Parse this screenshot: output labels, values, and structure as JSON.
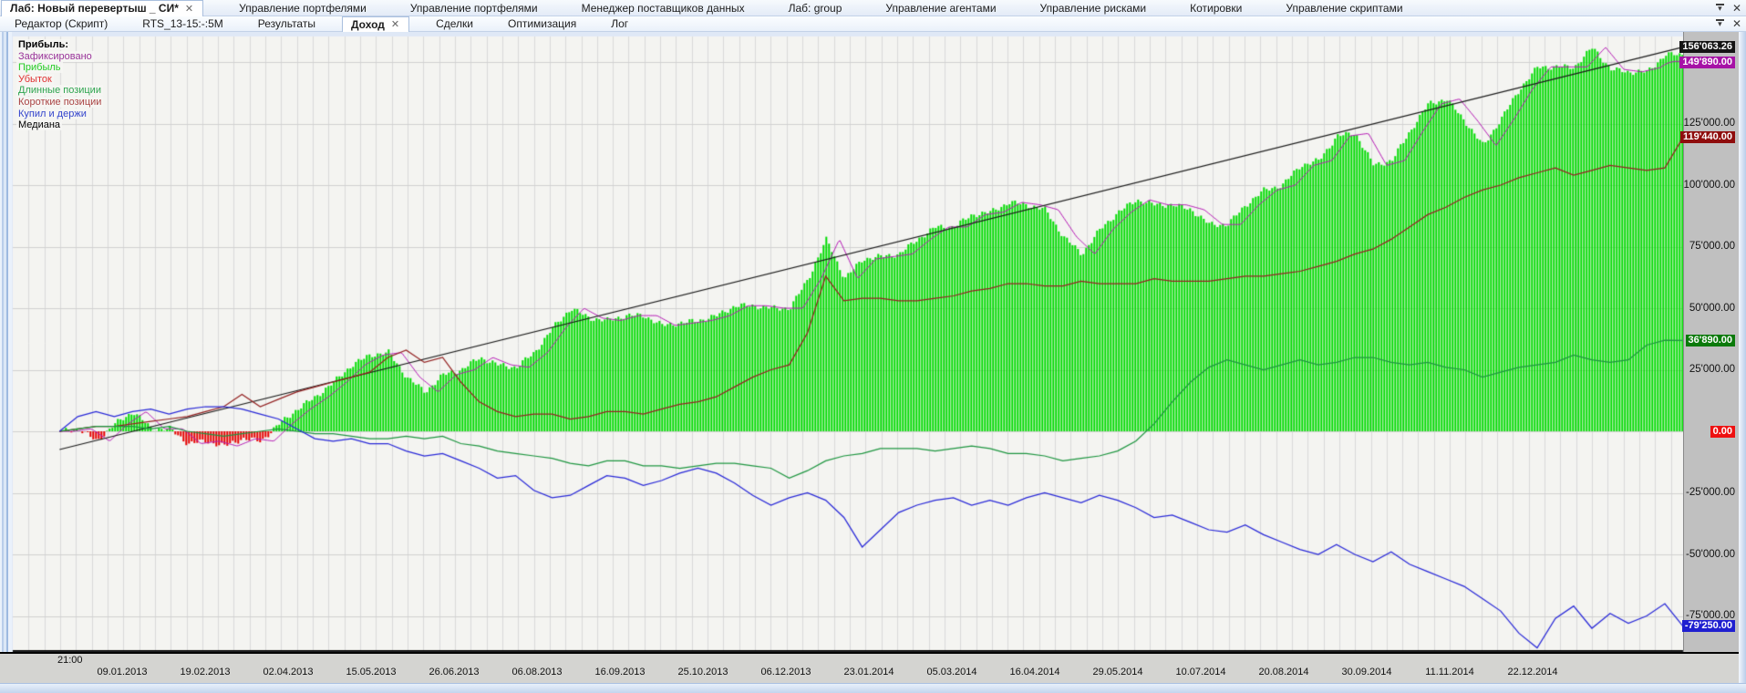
{
  "window": {
    "doc_tabs": [
      {
        "label": "Лаб: Новый перевертыш _ СИ*",
        "active": true,
        "closable": true
      },
      {
        "label": "Управление портфелями",
        "active": false,
        "closable": false
      },
      {
        "label": "Управление портфелями",
        "active": false,
        "closable": false
      },
      {
        "label": "Менеджер поставщиков данных",
        "active": false,
        "closable": false
      },
      {
        "label": "Лаб: group",
        "active": false,
        "closable": false
      },
      {
        "label": "Управление агентами",
        "active": false,
        "closable": false
      },
      {
        "label": "Управление рисками",
        "active": false,
        "closable": false
      },
      {
        "label": "Котировки",
        "active": false,
        "closable": false
      },
      {
        "label": "Управление скриптами",
        "active": false,
        "closable": false
      }
    ],
    "view_tabs": [
      {
        "label": "Редактор (Скрипт)",
        "active": false,
        "closable": false
      },
      {
        "label": "RTS_13-15:-:5M",
        "active": false,
        "closable": false
      },
      {
        "label": "Результаты",
        "active": false,
        "closable": false
      },
      {
        "label": "Доход",
        "active": true,
        "closable": true
      },
      {
        "label": "Сделки",
        "active": false,
        "closable": false
      },
      {
        "label": "Оптимизация",
        "active": false,
        "closable": false
      },
      {
        "label": "Лог",
        "active": false,
        "closable": false
      }
    ],
    "controls": {
      "menu_glyph": "▾",
      "close_glyph": "✕"
    }
  },
  "legend": {
    "title": "Прибыль:",
    "items": [
      {
        "label": "Зафиксировано",
        "color": "#993399"
      },
      {
        "label": "Прибыль",
        "color": "#22cc22"
      },
      {
        "label": "Убыток",
        "color": "#e03333"
      },
      {
        "label": "Длинные позиции",
        "color": "#2da44e"
      },
      {
        "label": "Короткие позиции",
        "color": "#aa4444"
      },
      {
        "label": "Купил и держи",
        "color": "#3344cc"
      },
      {
        "label": "Медиана",
        "color": "#000000"
      }
    ]
  },
  "chart_data": {
    "type": "area",
    "title": "Доход (equity and benchmark curves)",
    "values_scale": 1000,
    "x_start_frac": 0.028,
    "x_axis": {
      "time_label": "21:00",
      "labels": [
        "09.01.2013",
        "19.02.2013",
        "02.04.2013",
        "15.05.2013",
        "26.06.2013",
        "06.08.2013",
        "16.09.2013",
        "25.10.2013",
        "06.12.2013",
        "23.01.2014",
        "05.03.2014",
        "16.04.2014",
        "29.05.2014",
        "10.07.2014",
        "20.08.2014",
        "30.09.2014",
        "11.11.2014",
        "22.12.2014"
      ]
    },
    "y_axis": {
      "range": [
        -88500,
        163000
      ],
      "grid_step": 25000,
      "labels": [
        {
          "value": 156063.26,
          "text": "156'063.26",
          "style": "median"
        },
        {
          "value": 149890.0,
          "text": "149'890.00",
          "style": "fixed"
        },
        {
          "value": 125000.0,
          "text": "125'000.00",
          "style": "tick"
        },
        {
          "value": 119440.0,
          "text": "119'440.00",
          "style": "short"
        },
        {
          "value": 100000.0,
          "text": "100'000.00",
          "style": "tick"
        },
        {
          "value": 75000.0,
          "text": "75'000.00",
          "style": "tick"
        },
        {
          "value": 50000.0,
          "text": "50'000.00",
          "style": "tick"
        },
        {
          "value": 36890.0,
          "text": "36'890.00",
          "style": "long"
        },
        {
          "value": 25000.0,
          "text": "25'000.00",
          "style": "tick"
        },
        {
          "value": 0.0,
          "text": "0.00",
          "style": "zero"
        },
        {
          "value": -25000.0,
          "text": "-25'000.00",
          "style": "tick"
        },
        {
          "value": -50000.0,
          "text": "-50'000.00",
          "style": "tick"
        },
        {
          "value": -75000.0,
          "text": "-75'000.00",
          "style": "tick"
        },
        {
          "value": -79250.0,
          "text": "-79'250.00",
          "style": "buyhold"
        }
      ]
    },
    "colors": {
      "plot_bg": "#f4f4f1",
      "grid": "#dadada",
      "bar_profit": "#00dc00",
      "bar_loss": "#e60000",
      "fixed": "#b517b5",
      "short": "#942222",
      "long": "#1e9640",
      "buyhold": "#2828d8",
      "median": "#1a1a1a"
    },
    "equity_bars": {
      "name": "Прибыль / Убыток",
      "final": 153000,
      "values": [
        0,
        1,
        -4,
        3,
        8,
        1,
        1,
        -5,
        -4,
        -6,
        -3,
        -4,
        3,
        9,
        14,
        20,
        27,
        31,
        32,
        22,
        16,
        23,
        25,
        30,
        27,
        26,
        32,
        42,
        50,
        46,
        45,
        47,
        47,
        43,
        44,
        45,
        47,
        51,
        51,
        50,
        50,
        62,
        78,
        62,
        70,
        71,
        72,
        78,
        83,
        83,
        88,
        89,
        93,
        92,
        90,
        79,
        72,
        82,
        89,
        94,
        92,
        92,
        90,
        84,
        84,
        92,
        98,
        100,
        108,
        110,
        120,
        121,
        108,
        110,
        122,
        133,
        135,
        126,
        116,
        127,
        139,
        148,
        148,
        148,
        156,
        147,
        146,
        146,
        153,
        153
      ]
    },
    "fixed_final": 149890,
    "series": [
      {
        "name": "Короткие позиции",
        "key": "short",
        "final": 119440,
        "values": [
          0,
          1,
          2,
          2,
          3,
          4,
          5,
          6,
          8,
          10,
          15,
          10,
          13,
          16,
          18,
          20,
          22,
          24,
          30,
          33,
          28,
          30,
          20,
          12,
          8,
          6,
          7,
          7,
          5,
          6,
          8,
          8,
          7,
          9,
          11,
          12,
          14,
          18,
          22,
          25,
          27,
          40,
          63,
          53,
          54,
          54,
          53,
          53,
          54,
          55,
          57,
          58,
          60,
          60,
          59,
          59,
          61,
          60,
          60,
          60,
          62,
          61,
          61,
          61,
          62,
          63,
          63,
          64,
          65,
          67,
          69,
          72,
          74,
          78,
          83,
          88,
          91,
          95,
          98,
          100,
          103,
          105,
          107,
          104,
          106,
          108,
          107,
          106,
          107,
          119.4
        ]
      },
      {
        "name": "Длинные позиции",
        "key": "long",
        "final": 36890,
        "values": [
          0,
          1,
          2,
          2,
          2,
          1,
          2,
          0,
          -1,
          -2,
          -1,
          0,
          1,
          0,
          -1,
          -1,
          -2,
          -3,
          -3,
          -2,
          -3,
          -2,
          -5,
          -6,
          -8,
          -9,
          -10,
          -11,
          -13,
          -14,
          -12,
          -12,
          -14,
          -14,
          -15,
          -14,
          -13,
          -13,
          -14,
          -15,
          -19,
          -16,
          -12,
          -10,
          -9,
          -7,
          -7,
          -7,
          -8,
          -7,
          -6,
          -7,
          -9,
          -9,
          -10,
          -12,
          -11,
          -10,
          -8,
          -4,
          3,
          12,
          20,
          26,
          29,
          27,
          25,
          27,
          29,
          27,
          28,
          30,
          30,
          28,
          27,
          28,
          26,
          25,
          22,
          24,
          26,
          27,
          28,
          31,
          29,
          28,
          29,
          35,
          37,
          36.9
        ]
      },
      {
        "name": "Купил и держи",
        "key": "buyhold",
        "final": -79250,
        "values": [
          0,
          6,
          8,
          6,
          8,
          9,
          7,
          9,
          10,
          10,
          9,
          7,
          5,
          1,
          -3,
          -4,
          -3,
          -5,
          -5,
          -8,
          -10,
          -9,
          -12,
          -15,
          -19,
          -18,
          -24,
          -27,
          -26,
          -22,
          -18,
          -19,
          -22,
          -20,
          -17,
          -15,
          -17,
          -21,
          -26,
          -30,
          -27,
          -25,
          -28,
          -35,
          -47,
          -40,
          -33,
          -30,
          -28,
          -27,
          -30,
          -28,
          -30,
          -27,
          -25,
          -27,
          -29,
          -26,
          -28,
          -31,
          -35,
          -34,
          -37,
          -40,
          -41,
          -38,
          -42,
          -45,
          -48,
          -50,
          -46,
          -50,
          -53,
          -49,
          -54,
          -57,
          -60,
          -63,
          -68,
          -73,
          -82,
          -88,
          -76,
          -71,
          -80,
          -74,
          -78,
          -75,
          -70,
          -79.25
        ]
      },
      {
        "name": "Медиана",
        "key": "median",
        "final": 156063.26,
        "two_point": true,
        "values": [
          -7.4,
          156.063
        ]
      }
    ]
  }
}
